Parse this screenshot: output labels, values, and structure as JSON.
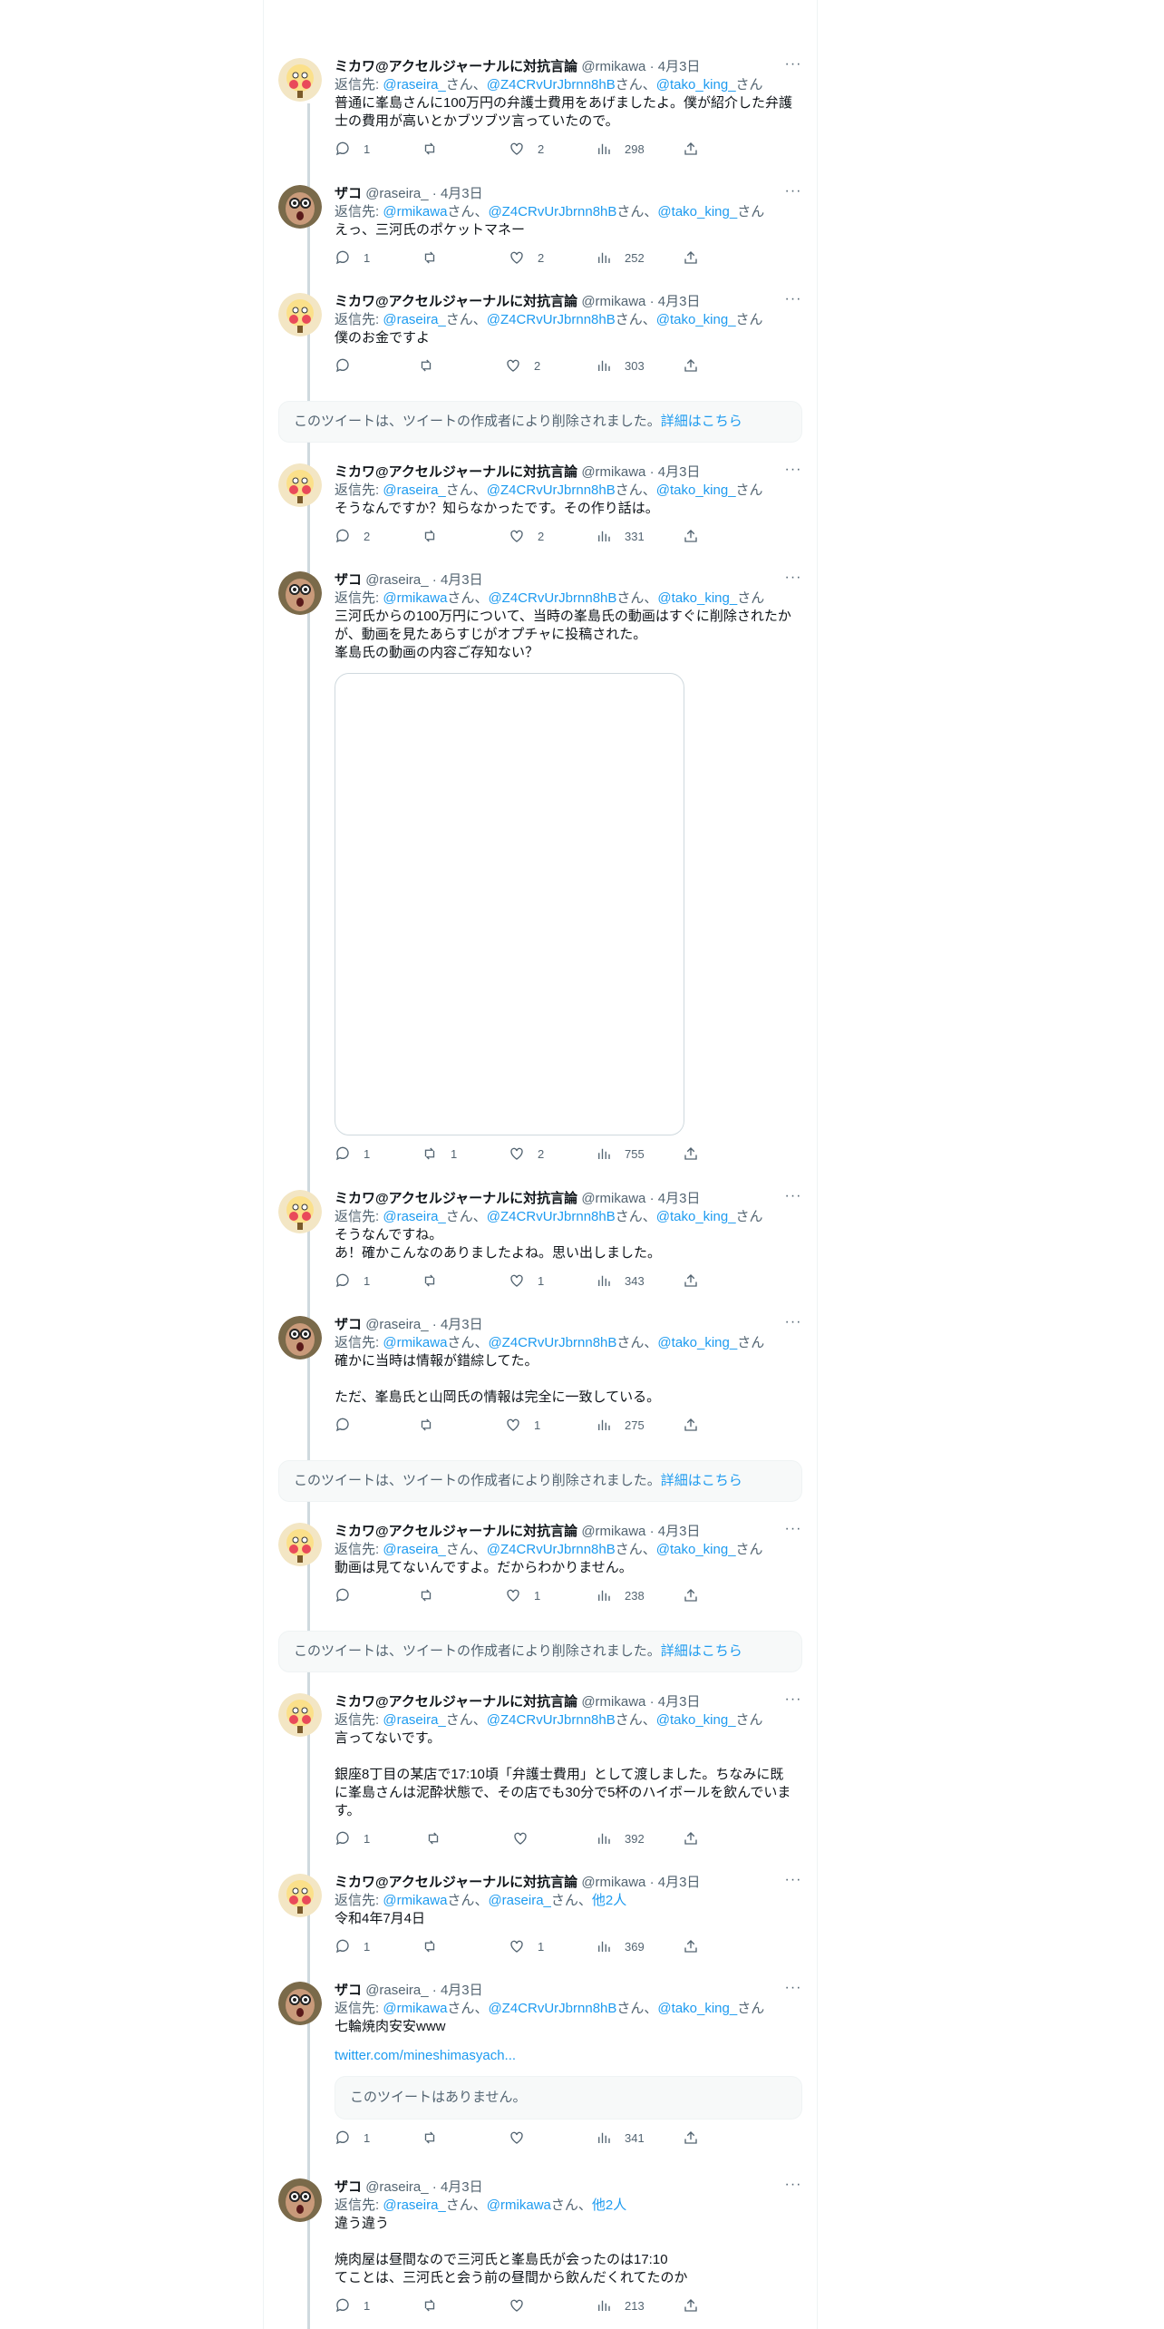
{
  "users": {
    "mikawa": {
      "name": "ミカワ@アクセルジャーナルに対抗言論",
      "handle": "@rmikawa"
    },
    "zako": {
      "name": "ザコ",
      "handle": "@raseira_"
    }
  },
  "common": {
    "dot": "·",
    "date": "4月3日",
    "reply_prefix": "返信先: ",
    "san": "さん",
    "sep": "、",
    "others": "他2人"
  },
  "deleted_notice": {
    "text": "このツイートは、ツイートの作成者により削除されました。",
    "link": "詳細はこちら"
  },
  "tweets": [
    {
      "author": "mikawa",
      "reply_to": [
        "@raseira_",
        "@Z4CRvUrJbrnn8hB",
        "@tako_king_"
      ],
      "lines": [
        "普通に峯島さんに100万円の弁護士費用をあげましたよ。僕が紹介した弁護",
        "士の費用が高いとかブツブツ言っていたので。"
      ],
      "stats": {
        "replies": "1",
        "retweets": "",
        "likes": "2",
        "views": "298"
      }
    },
    {
      "author": "zako",
      "reply_to": [
        "@rmikawa",
        "@Z4CRvUrJbrnn8hB",
        "@tako_king_"
      ],
      "lines": [
        "えっ、三河氏のポケットマネー"
      ],
      "stats": {
        "replies": "1",
        "retweets": "",
        "likes": "2",
        "views": "252"
      }
    },
    {
      "author": "mikawa",
      "reply_to": [
        "@raseira_",
        "@Z4CRvUrJbrnn8hB",
        "@tako_king_"
      ],
      "lines": [
        "僕のお金ですよ"
      ],
      "stats": {
        "replies": "",
        "retweets": "",
        "likes": "2",
        "views": "303"
      }
    },
    {
      "author": "mikawa",
      "reply_to": [
        "@raseira_",
        "@Z4CRvUrJbrnn8hB",
        "@tako_king_"
      ],
      "lines": [
        "そうなんですか？知らなかったです。その作り話は。"
      ],
      "stats": {
        "replies": "2",
        "retweets": "",
        "likes": "2",
        "views": "331"
      }
    },
    {
      "author": "zako",
      "reply_to": [
        "@rmikawa",
        "@Z4CRvUrJbrnn8hB",
        "@tako_king_"
      ],
      "lines": [
        "三河氏からの100万円について、当時の峯島氏の動画はすぐに削除されたか",
        "が、動画を見たあらすじがオプチャに投稿された。",
        "峯島氏の動画の内容ご存知ない？"
      ],
      "stats": {
        "replies": "1",
        "retweets": "1",
        "likes": "2",
        "views": "755"
      }
    },
    {
      "author": "mikawa",
      "reply_to": [
        "@raseira_",
        "@Z4CRvUrJbrnn8hB",
        "@tako_king_"
      ],
      "lines": [
        "そうなんですね。",
        "あ！確かこんなのありましたよね。思い出しました。"
      ],
      "stats": {
        "replies": "1",
        "retweets": "",
        "likes": "1",
        "views": "343"
      }
    },
    {
      "author": "zako",
      "reply_to": [
        "@rmikawa",
        "@Z4CRvUrJbrnn8hB",
        "@tako_king_"
      ],
      "lines": [
        "確かに当時は情報が錯綜してた。",
        "",
        "ただ、峯島氏と山岡氏の情報は完全に一致している。"
      ],
      "stats": {
        "replies": "",
        "retweets": "",
        "likes": "1",
        "views": "275"
      }
    },
    {
      "author": "mikawa",
      "reply_to": [
        "@raseira_",
        "@Z4CRvUrJbrnn8hB",
        "@tako_king_"
      ],
      "lines": [
        "動画は見てないんですよ。だからわかりません。"
      ],
      "stats": {
        "replies": "",
        "retweets": "",
        "likes": "1",
        "views": "238"
      }
    },
    {
      "author": "mikawa",
      "reply_to": [
        "@raseira_",
        "@Z4CRvUrJbrnn8hB",
        "@tako_king_"
      ],
      "lines": [
        "言ってないです。",
        "",
        "銀座8丁目の某店で17:10頃「弁護士費用」として渡しました。ちなみに既",
        "に峯島さんは泥酔状態で、その店でも30分で5杯のハイボールを飲んでいま",
        "す。"
      ],
      "stats": {
        "replies": "1",
        "retweets": "",
        "likes": "",
        "views": "392"
      }
    },
    {
      "author": "mikawa",
      "reply_to_short": [
        "@rmikawa",
        "@raseira_"
      ],
      "lines": [
        "令和4年7月4日"
      ],
      "stats": {
        "replies": "1",
        "retweets": "",
        "likes": "1",
        "views": "369"
      }
    },
    {
      "author": "zako",
      "reply_to": [
        "@rmikawa",
        "@Z4CRvUrJbrnn8hB",
        "@tako_king_"
      ],
      "lines": [
        "七輪焼肉安安www"
      ],
      "link": "twitter.com/mineshimasyach...",
      "quote_unavailable": "このツイートはありません。",
      "stats": {
        "replies": "1",
        "retweets": "",
        "likes": "",
        "views": "341"
      }
    },
    {
      "author": "zako",
      "reply_to_short": [
        "@raseira_",
        "@rmikawa"
      ],
      "lines": [
        "違う違う",
        "",
        "焼肉屋は昼間なので三河氏と峯島氏が会ったのは17:10",
        "てことは、三河氏と会う前の昼間から飲んだくれてたのか"
      ],
      "stats": {
        "replies": "1",
        "retweets": "",
        "likes": "",
        "views": "213"
      }
    }
  ]
}
